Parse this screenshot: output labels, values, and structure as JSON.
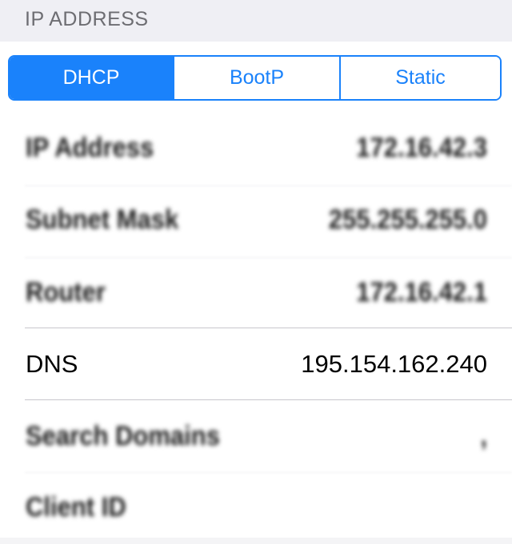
{
  "section": {
    "title": "IP ADDRESS"
  },
  "segmented_control": {
    "selected": "DHCP",
    "options": [
      "DHCP",
      "BootP",
      "Static"
    ]
  },
  "rows": [
    {
      "label": "IP Address",
      "value": "172.16.42.3",
      "blurred": true
    },
    {
      "label": "Subnet Mask",
      "value": "255.255.255.0",
      "blurred": true
    },
    {
      "label": "Router",
      "value": "172.16.42.1",
      "blurred": true
    },
    {
      "label": "DNS",
      "value": "195.154.162.240",
      "blurred": false
    },
    {
      "label": "Search Domains",
      "value": ",",
      "blurred": true
    },
    {
      "label": "Client ID",
      "value": "",
      "blurred": true
    }
  ],
  "colors": {
    "accent": "#1a82fb",
    "group_background": "#efeff4",
    "section_header_text": "#6d6d72",
    "separator": "#c8c7cc"
  }
}
